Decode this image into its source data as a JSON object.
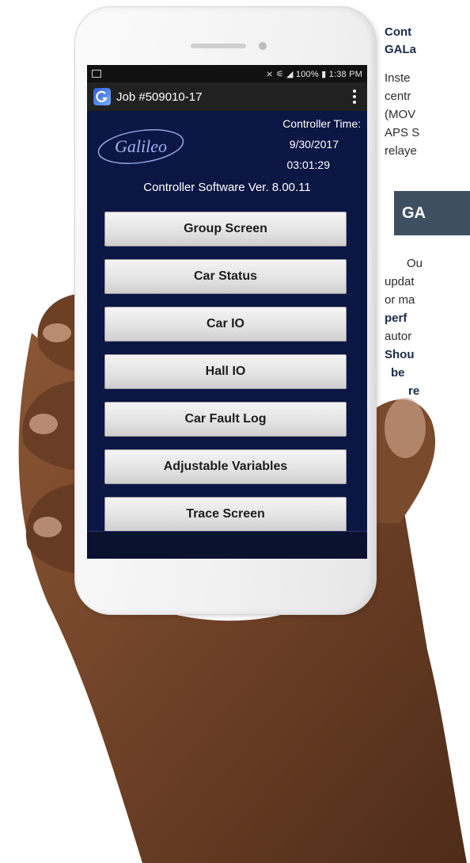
{
  "status_bar": {
    "right_text": "⨯ ⚟ ◢ 100% ▮ 1:38 PM"
  },
  "action_bar": {
    "title": "Job #509010-17"
  },
  "header": {
    "logo_text": "Galileo",
    "controller_time_label": "Controller Time:",
    "date": "9/30/2017",
    "time": "03:01:29",
    "software_version": "Controller Software Ver. 8.00.11"
  },
  "menu": {
    "group_screen": "Group Screen",
    "car_status": "Car Status",
    "car_io": "Car IO",
    "hall_io": "Hall IO",
    "car_fault_log": "Car Fault Log",
    "adjustable_variables": "Adjustable Variables",
    "trace_screen": "Trace Screen"
  },
  "side_text": {
    "line1": "Cont",
    "line2": "GALa",
    "line3": "Inste",
    "line4": "centr",
    "line5": "(MOV",
    "line6": "APS S",
    "line7": "relaye",
    "heading": "GA",
    "line8": "Ou",
    "line9": "updat",
    "line10": "or ma",
    "line11": "perf",
    "line12": "autor",
    "line13": "Shou",
    "line14": "be",
    "line15": "re"
  },
  "colors": {
    "screen_bg": "#0c1644",
    "heading_bg": "#3d4f61",
    "skin": "#7a4a2c"
  }
}
